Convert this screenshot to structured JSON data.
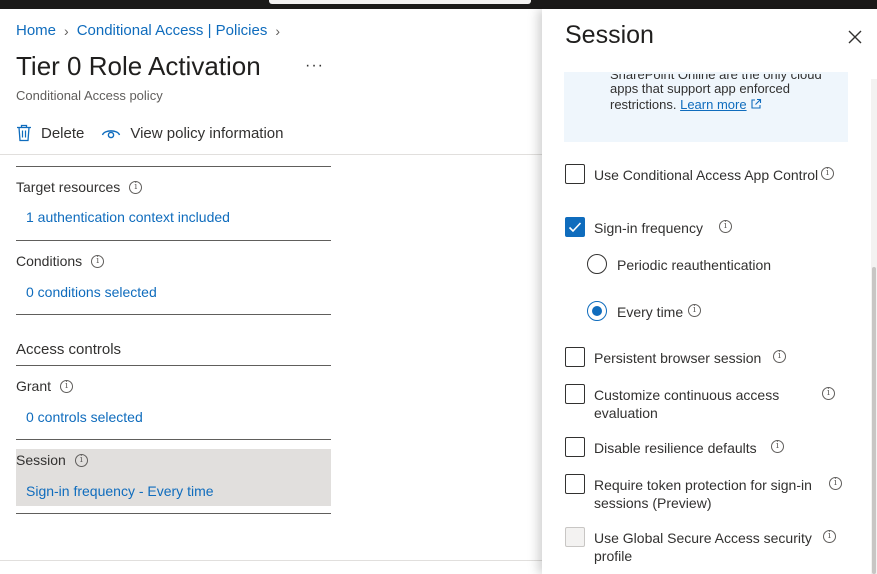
{
  "breadcrumb": {
    "home": "Home",
    "policies": "Conditional Access | Policies"
  },
  "page": {
    "title": "Tier 0 Role Activation",
    "subtitle": "Conditional Access policy",
    "more": "···"
  },
  "toolbar": {
    "delete_label": "Delete",
    "view_info_label": "View policy information"
  },
  "sections": {
    "target_resources": {
      "label": "Target resources",
      "value": "1 authentication context included"
    },
    "conditions": {
      "label": "Conditions",
      "value": "0 conditions selected"
    },
    "access_controls": {
      "heading": "Access controls"
    },
    "grant": {
      "label": "Grant",
      "value": "0 controls selected"
    },
    "session": {
      "label": "Session",
      "value": "Sign-in frequency - Every time"
    }
  },
  "panel": {
    "title": "Session",
    "info_text_cut": "SharePoint Online are the only cloud",
    "info_text_line2": "apps that support app enforced",
    "info_text_line3": "restrictions.",
    "learn_more": "Learn more",
    "options": [
      {
        "label": "Use Conditional Access App Control",
        "checked": false
      },
      {
        "label": "Sign-in frequency",
        "checked": true
      },
      {
        "label": "Persistent browser session",
        "checked": false
      },
      {
        "label": "Customize continuous access evaluation",
        "checked": false
      },
      {
        "label": "Disable resilience defaults",
        "checked": false
      },
      {
        "label": "Require token protection for sign-in sessions (Preview)",
        "checked": false
      },
      {
        "label": "Use Global Secure Access security profile",
        "checked": false,
        "disabled": true
      }
    ],
    "frequency_options": [
      {
        "label": "Periodic reauthentication",
        "selected": false
      },
      {
        "label": "Every time",
        "selected": true
      }
    ]
  },
  "colors": {
    "accent": "#0f6cbd",
    "highlight": "#e1dfdd",
    "infobox": "#eff6fc"
  }
}
